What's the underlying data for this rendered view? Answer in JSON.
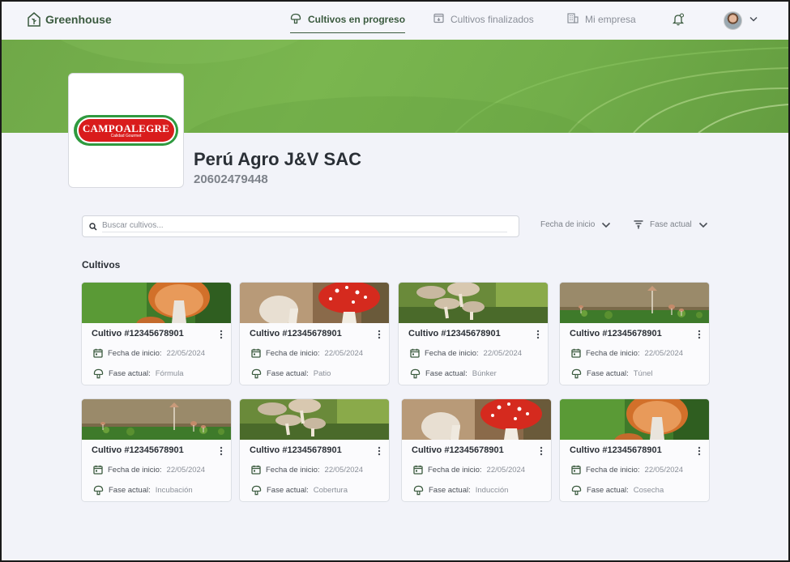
{
  "app": {
    "name": "Greenhouse"
  },
  "nav": {
    "items": [
      {
        "label": "Cultivos en progreso",
        "icon": "mushroom-icon",
        "active": true
      },
      {
        "label": "Cultivos finalizados",
        "icon": "archive-box-icon",
        "active": false
      },
      {
        "label": "Mi empresa",
        "icon": "building-icon",
        "active": false
      }
    ]
  },
  "company": {
    "name": "Perú Agro J&V SAC",
    "ruc": "20602479448",
    "logo": {
      "brand": "CAMPOALEGRE",
      "tagline": "Calidad Gourmet"
    }
  },
  "search": {
    "placeholder": "Buscar cultivos..."
  },
  "filters": {
    "start_date": "Fecha de inicio",
    "phase": "Fase actual"
  },
  "section_title": "Cultivos",
  "labels": {
    "start_date": "Fecha de inicio:",
    "phase": "Fase actual:"
  },
  "colors": {
    "brand_green": "#3a5a3e",
    "banner": "#72ae4a",
    "logo_red": "#d91c1c"
  },
  "cards": [
    {
      "title": "Cultivo #12345678901",
      "start_date": "22/05/2024",
      "phase": "Fórmula",
      "image": "orange-mushroom"
    },
    {
      "title": "Cultivo #12345678901",
      "start_date": "22/05/2024",
      "phase": "Patio",
      "image": "red-amanita"
    },
    {
      "title": "Cultivo #12345678901",
      "start_date": "22/05/2024",
      "phase": "Búnker",
      "image": "brown-mushrooms"
    },
    {
      "title": "Cultivo #12345678901",
      "start_date": "22/05/2024",
      "phase": "Túnel",
      "image": "tiny-mushrooms"
    },
    {
      "title": "Cultivo #12345678901",
      "start_date": "22/05/2024",
      "phase": "Incubación",
      "image": "tiny-mushrooms"
    },
    {
      "title": "Cultivo #12345678901",
      "start_date": "22/05/2024",
      "phase": "Cobertura",
      "image": "brown-mushrooms"
    },
    {
      "title": "Cultivo #12345678901",
      "start_date": "22/05/2024",
      "phase": "Inducción",
      "image": "red-amanita"
    },
    {
      "title": "Cultivo #12345678901",
      "start_date": "22/05/2024",
      "phase": "Cosecha",
      "image": "orange-mushroom"
    }
  ]
}
